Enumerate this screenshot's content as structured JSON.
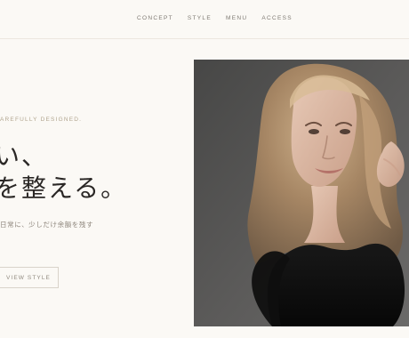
{
  "nav": {
    "items": [
      {
        "label": "CONCEPT"
      },
      {
        "label": "STYLE"
      },
      {
        "label": "MENU"
      },
      {
        "label": "ACCESS"
      }
    ]
  },
  "hero": {
    "tagline": "AREFULLY DESIGNED.",
    "headline_line1": "い、",
    "headline_line2": "を整える。",
    "subtext": "日常に、少しだけ余韻を残す",
    "cta_label": "VIEW STYLE"
  },
  "theme": {
    "background": "#fbf9f5",
    "text_dark": "#2a2725",
    "text_muted": "#8d857b",
    "accent_tan": "#b1a58f",
    "border": "#d9d3ca"
  },
  "image": {
    "icon_name": "hero-portrait-image"
  }
}
